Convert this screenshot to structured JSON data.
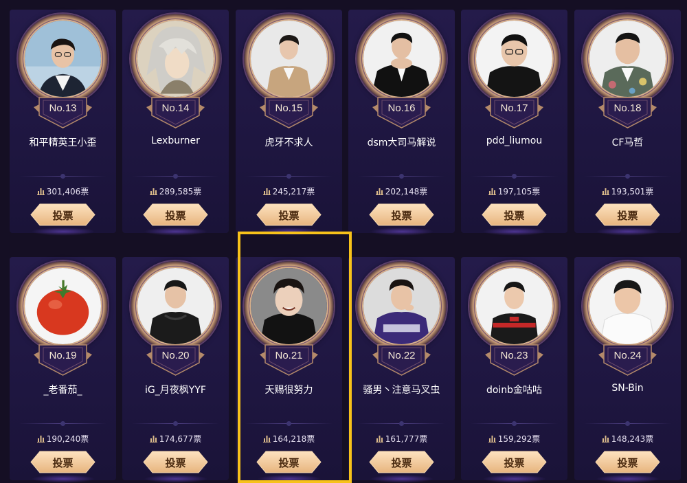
{
  "vote_label": "投票",
  "colors": {
    "highlight": "#f7c21a",
    "card_bg": "#1e1640",
    "button_gold": "#f0c490",
    "frame_gold": "#caa07a"
  },
  "cards": [
    {
      "rank": "No.13",
      "name": "和平精英王小歪",
      "votes": "301,406票",
      "avatar": "man-white-shirt-dark-jacket",
      "highlighted": false
    },
    {
      "rank": "No.14",
      "name": "Lexburner",
      "votes": "289,585票",
      "avatar": "anime-silver-hair",
      "highlighted": false
    },
    {
      "rank": "No.15",
      "name": "虎牙不求人",
      "votes": "245,217票",
      "avatar": "man-beige-blazer",
      "highlighted": false
    },
    {
      "rank": "No.16",
      "name": "dsm大司马解说",
      "votes": "202,148票",
      "avatar": "man-black-suit-hands-clasped",
      "highlighted": false
    },
    {
      "rank": "No.17",
      "name": "pdd_liumou",
      "votes": "197,105票",
      "avatar": "man-glasses-black-suit",
      "highlighted": false
    },
    {
      "rank": "No.18",
      "name": "CF马哲",
      "votes": "193,501票",
      "avatar": "man-floral-shirt",
      "highlighted": false
    },
    {
      "rank": "No.19",
      "name": "_老番茄_",
      "votes": "190,240票",
      "avatar": "tomato",
      "highlighted": false
    },
    {
      "rank": "No.20",
      "name": "iG_月夜枫YYF",
      "votes": "174,677票",
      "avatar": "man-black-hoodie",
      "highlighted": false
    },
    {
      "rank": "No.21",
      "name": "天赐很努力",
      "votes": "164,218票",
      "avatar": "man-black-sweater-smiling",
      "highlighted": true
    },
    {
      "rank": "No.22",
      "name": "骚男丶注意马叉虫",
      "votes": "161,777票",
      "avatar": "man-purple-hoodie",
      "highlighted": false
    },
    {
      "rank": "No.23",
      "name": "doinb金咕咕",
      "votes": "159,292票",
      "avatar": "man-esports-jersey",
      "highlighted": false
    },
    {
      "rank": "No.24",
      "name": "SN-Bin",
      "votes": "148,243票",
      "avatar": "man-white-tshirt",
      "highlighted": false
    }
  ]
}
